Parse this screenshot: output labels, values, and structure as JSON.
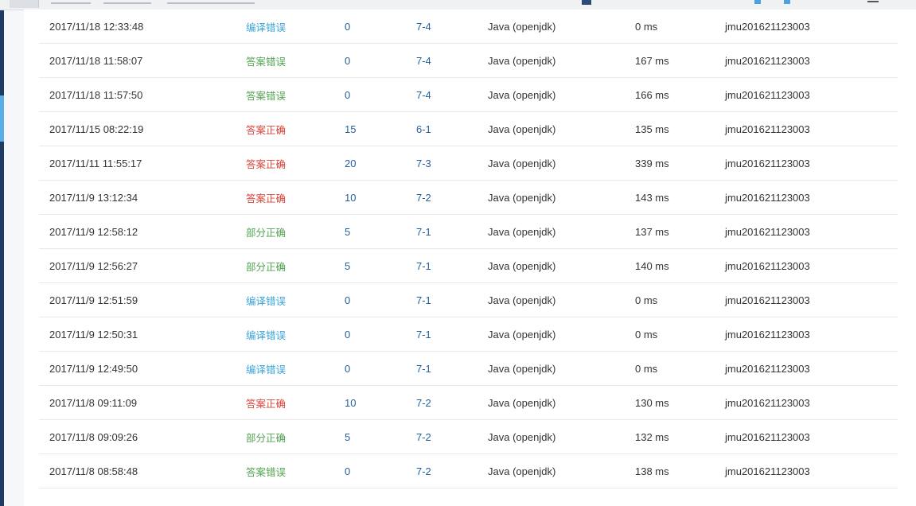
{
  "colors": {
    "compile_error": "#3aa3d9",
    "wrong_answer": "#53a351",
    "partial_correct": "#53a351",
    "correct": "#d9443a",
    "link": "#25609c",
    "sidebar": "#1f3b64",
    "sidebar_accent": "#5ab0e6"
  },
  "submissions": [
    {
      "time": "2017/11/18 12:33:48",
      "status": "编译错误",
      "status_type": "compile",
      "score": "0",
      "problem": "7-4",
      "language": "Java (openjdk)",
      "time_used": "0 ms",
      "user": "jmu201621123003"
    },
    {
      "time": "2017/11/18 11:58:07",
      "status": "答案错误",
      "status_type": "wrong",
      "score": "0",
      "problem": "7-4",
      "language": "Java (openjdk)",
      "time_used": "167 ms",
      "user": "jmu201621123003"
    },
    {
      "time": "2017/11/18 11:57:50",
      "status": "答案错误",
      "status_type": "wrong",
      "score": "0",
      "problem": "7-4",
      "language": "Java (openjdk)",
      "time_used": "166 ms",
      "user": "jmu201621123003"
    },
    {
      "time": "2017/11/15 08:22:19",
      "status": "答案正确",
      "status_type": "correct",
      "score": "15",
      "problem": "6-1",
      "language": "Java (openjdk)",
      "time_used": "135 ms",
      "user": "jmu201621123003"
    },
    {
      "time": "2017/11/11 11:55:17",
      "status": "答案正确",
      "status_type": "correct",
      "score": "20",
      "problem": "7-3",
      "language": "Java (openjdk)",
      "time_used": "339 ms",
      "user": "jmu201621123003"
    },
    {
      "time": "2017/11/9 13:12:34",
      "status": "答案正确",
      "status_type": "correct",
      "score": "10",
      "problem": "7-2",
      "language": "Java (openjdk)",
      "time_used": "143 ms",
      "user": "jmu201621123003"
    },
    {
      "time": "2017/11/9 12:58:12",
      "status": "部分正确",
      "status_type": "partial",
      "score": "5",
      "problem": "7-1",
      "language": "Java (openjdk)",
      "time_used": "137 ms",
      "user": "jmu201621123003"
    },
    {
      "time": "2017/11/9 12:56:27",
      "status": "部分正确",
      "status_type": "partial",
      "score": "5",
      "problem": "7-1",
      "language": "Java (openjdk)",
      "time_used": "140 ms",
      "user": "jmu201621123003"
    },
    {
      "time": "2017/11/9 12:51:59",
      "status": "编译错误",
      "status_type": "compile",
      "score": "0",
      "problem": "7-1",
      "language": "Java (openjdk)",
      "time_used": "0 ms",
      "user": "jmu201621123003"
    },
    {
      "time": "2017/11/9 12:50:31",
      "status": "编译错误",
      "status_type": "compile",
      "score": "0",
      "problem": "7-1",
      "language": "Java (openjdk)",
      "time_used": "0 ms",
      "user": "jmu201621123003"
    },
    {
      "time": "2017/11/9 12:49:50",
      "status": "编译错误",
      "status_type": "compile",
      "score": "0",
      "problem": "7-1",
      "language": "Java (openjdk)",
      "time_used": "0 ms",
      "user": "jmu201621123003"
    },
    {
      "time": "2017/11/8 09:11:09",
      "status": "答案正确",
      "status_type": "correct",
      "score": "10",
      "problem": "7-2",
      "language": "Java (openjdk)",
      "time_used": "130 ms",
      "user": "jmu201621123003"
    },
    {
      "time": "2017/11/8 09:09:26",
      "status": "部分正确",
      "status_type": "partial",
      "score": "5",
      "problem": "7-2",
      "language": "Java (openjdk)",
      "time_used": "132 ms",
      "user": "jmu201621123003"
    },
    {
      "time": "2017/11/8 08:58:48",
      "status": "答案错误",
      "status_type": "wrong",
      "score": "0",
      "problem": "7-2",
      "language": "Java (openjdk)",
      "time_used": "138 ms",
      "user": "jmu201621123003"
    }
  ]
}
